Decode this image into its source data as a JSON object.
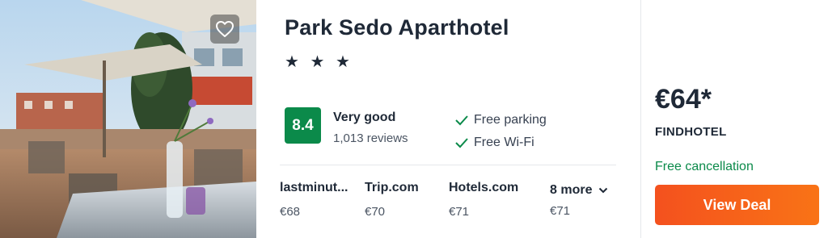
{
  "hotel": {
    "name": "Park Sedo Aparthotel",
    "stars": "★ ★ ★",
    "score": "8.4",
    "rating_word": "Very good",
    "reviews": "1,013 reviews",
    "amenities": [
      "Free parking",
      "Free Wi-Fi"
    ]
  },
  "providers": [
    {
      "name": "lastminut...",
      "price": "€68"
    },
    {
      "name": "Trip.com",
      "price": "€70"
    },
    {
      "name": "Hotels.com",
      "price": "€71"
    }
  ],
  "more": {
    "label": "8 more",
    "price": "€71"
  },
  "deal": {
    "price": "€64*",
    "provider": "FINDHOTEL",
    "cancellation": "Free cancellation",
    "button_label": "View Deal"
  },
  "colors": {
    "score_badge": "#0b8a4a",
    "cancellation": "#0b8a4a",
    "deal_button": "#f4511e"
  },
  "icons": {
    "favorite": "heart-icon",
    "amenity": "check-icon",
    "more": "chevron-down-icon"
  }
}
